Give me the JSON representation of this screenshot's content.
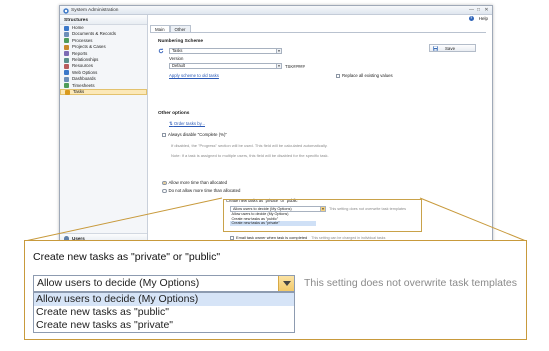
{
  "window": {
    "title": "System Administration",
    "controls": [
      "—",
      "□",
      "✕"
    ]
  },
  "sidebar": {
    "header": "Structures",
    "items": [
      {
        "label": "Home",
        "icon": "home-icon",
        "color": "#3b78c9"
      },
      {
        "label": "Documents & Records",
        "icon": "documents-icon",
        "color": "#6d8fb8"
      },
      {
        "label": "Processes",
        "icon": "processes-icon",
        "color": "#4f9c5a"
      },
      {
        "label": "Projects & Cases",
        "icon": "projects-icon",
        "color": "#c98a2b"
      },
      {
        "label": "Reports",
        "icon": "reports-icon",
        "color": "#7d6bb5"
      },
      {
        "label": "Relationships",
        "icon": "relationships-icon",
        "color": "#5b8f8a"
      },
      {
        "label": "Resources",
        "icon": "resources-icon",
        "color": "#b85c5c"
      },
      {
        "label": "Web Options",
        "icon": "web-options-icon",
        "color": "#3b78c9"
      },
      {
        "label": "Dashboards",
        "icon": "dashboards-icon",
        "color": "#6d8fb8"
      },
      {
        "label": "Timesheets",
        "icon": "timesheets-icon",
        "color": "#4f9c5a"
      },
      {
        "label": "Tasks",
        "icon": "tasks-icon",
        "color": "#d99a1e",
        "selected": true
      }
    ],
    "users_label": "Users"
  },
  "header": {
    "help_label": "Help"
  },
  "tabs": [
    {
      "label": "Main",
      "active": true
    },
    {
      "label": "Other",
      "active": false
    }
  ],
  "numbering": {
    "title": "Numbering Scheme",
    "scheme_value": "Tasks",
    "version_label": "Version",
    "version_value": "Default",
    "code_value": "TSK#####",
    "apply_link": "Apply scheme to old tasks",
    "replace_label": "Replace all existing values"
  },
  "save_label": "Save",
  "other": {
    "title": "Other options",
    "order_link": "Order tasks by...",
    "always_disable_label": "Always disable \"Complete (%)\"",
    "note1": "If disabled, the \"Progress\" section will be used. This field will be calculated automatically.",
    "note2": "Note: If a task is assigned to multiple users, this field will be disabled for the specific task.",
    "allow_more_label": "Allow more time than allocated",
    "no_allow_label": "Do not allow more time than allocated"
  },
  "create_tasks": {
    "label": "Create new tasks as \"private\" or \"public\"",
    "selected": "Allow users to decide (My Options)",
    "note": "This setting does not overwrite task templates",
    "options": [
      "Allow users to decide (My Options)",
      "Create new tasks as \"public\"",
      "Create new tasks as \"private\""
    ],
    "highlighted_option_mini": 2,
    "highlighted_option_zoom": 0
  },
  "email_owner": {
    "label": "Email task owner when task is completed",
    "note": "This setting can be changed in individual tasks"
  },
  "colors": {
    "accent": "#d99a1e",
    "link": "#2a59b6",
    "callout_border": "#c89a3c",
    "selection": "#d6e4f7"
  }
}
